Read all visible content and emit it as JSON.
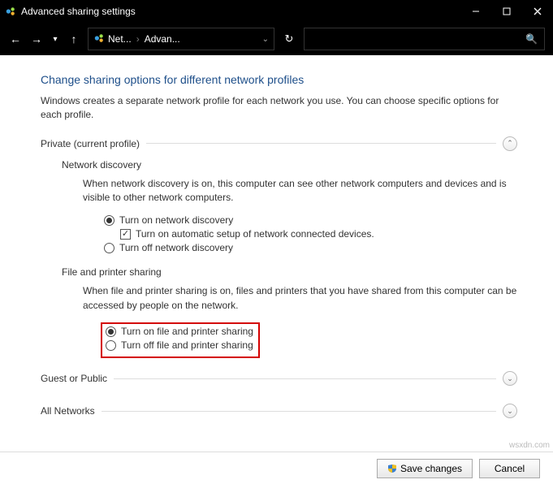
{
  "window": {
    "title": "Advanced sharing settings"
  },
  "breadcrumb": {
    "item1": "Net...",
    "item2": "Advan..."
  },
  "heading": "Change sharing options for different network profiles",
  "description": "Windows creates a separate network profile for each network you use. You can choose specific options for each profile.",
  "sections": {
    "private": {
      "title": "Private (current profile)",
      "network_discovery": {
        "title": "Network discovery",
        "desc": "When network discovery is on, this computer can see other network computers and devices and is visible to other network computers.",
        "opt_on": "Turn on network discovery",
        "opt_auto": "Turn on automatic setup of network connected devices.",
        "opt_off": "Turn off network discovery"
      },
      "file_printer": {
        "title": "File and printer sharing",
        "desc": "When file and printer sharing is on, files and printers that you have shared from this computer can be accessed by people on the network.",
        "opt_on": "Turn on file and printer sharing",
        "opt_off": "Turn off file and printer sharing"
      }
    },
    "guest": {
      "title": "Guest or Public"
    },
    "all": {
      "title": "All Networks"
    }
  },
  "buttons": {
    "save": "Save changes",
    "cancel": "Cancel"
  },
  "watermark": "wsxdn.com"
}
